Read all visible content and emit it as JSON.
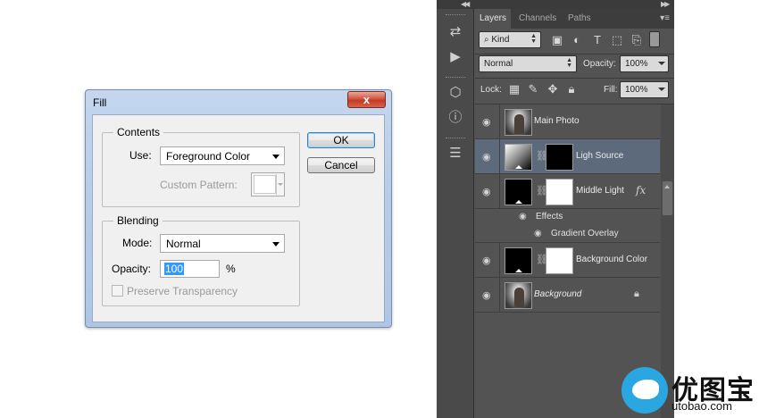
{
  "dialog": {
    "title": "Fill",
    "close_label": "x",
    "contents": {
      "legend": "Contents",
      "use_label": "Use:",
      "use_value": "Foreground Color",
      "pattern_label": "Custom Pattern:"
    },
    "blending": {
      "legend": "Blending",
      "mode_label": "Mode:",
      "mode_value": "Normal",
      "opacity_label": "Opacity:",
      "opacity_value": "100",
      "opacity_unit": "%",
      "preserve_label": "Preserve Transparency",
      "preserve_checked": false
    },
    "ok_label": "OK",
    "cancel_label": "Cancel"
  },
  "panel": {
    "tabs": [
      {
        "label": "Layers",
        "active": true
      },
      {
        "label": "Channels",
        "active": false
      },
      {
        "label": "Paths",
        "active": false
      }
    ],
    "filter": {
      "label": "Kind"
    },
    "blend_mode": "Normal",
    "opacity_label": "Opacity:",
    "opacity_value": "100%",
    "lock_label": "Lock:",
    "fill_label": "Fill:",
    "fill_value": "100%",
    "layers": [
      {
        "name": "Main Photo"
      },
      {
        "name": "Ligh Source"
      },
      {
        "name": "Middle Light",
        "fx": "fx",
        "effects_label": "Effects",
        "effect_item": "Gradient Overlay"
      },
      {
        "name": "Background Color"
      },
      {
        "name": "Background"
      }
    ]
  },
  "watermark": {
    "brand": "优图宝",
    "url": "utobao.com"
  },
  "colors": {
    "dialog_frame": "#b8cde9",
    "panel_bg": "#535353",
    "selected_layer": "#5c6a7b",
    "watermark_blue": "#2aa6e0"
  }
}
